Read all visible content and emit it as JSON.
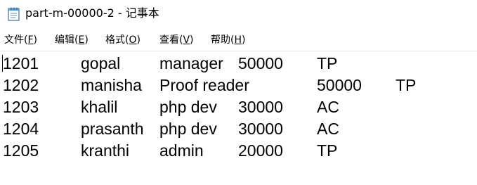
{
  "window": {
    "title": "part-m-00000-2 - 记事本",
    "icon": "notepad-icon"
  },
  "menu": [
    {
      "label": "文件(",
      "key": "F",
      "end": ")"
    },
    {
      "label": "编辑(",
      "key": "E",
      "end": ")"
    },
    {
      "label": "格式(",
      "key": "O",
      "end": ")"
    },
    {
      "label": "查看(",
      "key": "V",
      "end": ")"
    },
    {
      "label": "帮助(",
      "key": "H",
      "end": ")"
    }
  ],
  "content": {
    "rows": [
      [
        "1201",
        "gopal",
        "manager",
        "50000",
        "TP"
      ],
      [
        "1202",
        "manisha",
        "Proof reader",
        "50000",
        "TP"
      ],
      [
        "1203",
        "khalil",
        "php dev",
        "30000",
        "AC"
      ],
      [
        "1204",
        "prasanth",
        "php dev",
        "30000",
        "AC"
      ],
      [
        "1205",
        "kranthi",
        "admin",
        "20000",
        "TP"
      ]
    ]
  }
}
